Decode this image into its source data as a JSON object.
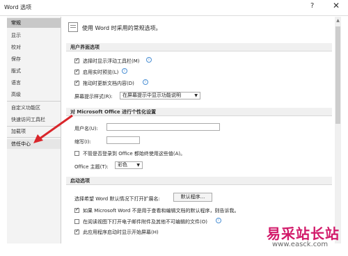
{
  "window": {
    "title": "Word 选项",
    "help": "?",
    "close": "✕"
  },
  "sidebar": {
    "items": [
      "常规",
      "显示",
      "校对",
      "保存",
      "版式",
      "语言",
      "高级",
      "自定义功能区",
      "快速访问工具栏",
      "加载项",
      "信任中心"
    ]
  },
  "intro": "使用 Word 时采用的常规选项。",
  "ui_section": {
    "header": "用户界面选项",
    "options": [
      {
        "label": "选择时显示浮动工具栏(M)",
        "checked": true
      },
      {
        "label": "启用实时预览(L)",
        "checked": true
      },
      {
        "label": "拖动时更新文档内容(D)",
        "checked": true
      }
    ],
    "screentip_label": "屏幕提示样式(R):",
    "screentip_value": "在屏幕提示中显示功能说明"
  },
  "personalize_section": {
    "header": "对 Microsoft Office 进行个性化设置",
    "username_label": "用户名(U):",
    "username_value": "",
    "initials_label": "缩写(I):",
    "initials_value": "",
    "always_use_label": "不管是否登录到 Office 都始终使用这些值(A)。",
    "always_use_checked": false,
    "theme_label": "Office 主题(T):",
    "theme_value": "彩色"
  },
  "startup_section": {
    "header": "启动选项",
    "default_ext_label": "选择希望 Word 默认情况下打开扩展名:",
    "default_programs_button": "默认程序...",
    "options": [
      {
        "label": "如果 Microsoft Word 不是用于查看和编辑文档的默认程序，则告诉我。",
        "checked": true
      },
      {
        "label": "在阅读视图下打开电子邮件附件及其他不可编辑的文件(O)",
        "checked": false
      },
      {
        "label": "此应用程序启动时显示开始屏幕(H)",
        "checked": true
      }
    ]
  },
  "watermark": {
    "text": "易采站长站",
    "url": "www.easck.com"
  },
  "colors": {
    "annotation_arrow": "#d9262b",
    "watermark": "#d21a6a"
  }
}
